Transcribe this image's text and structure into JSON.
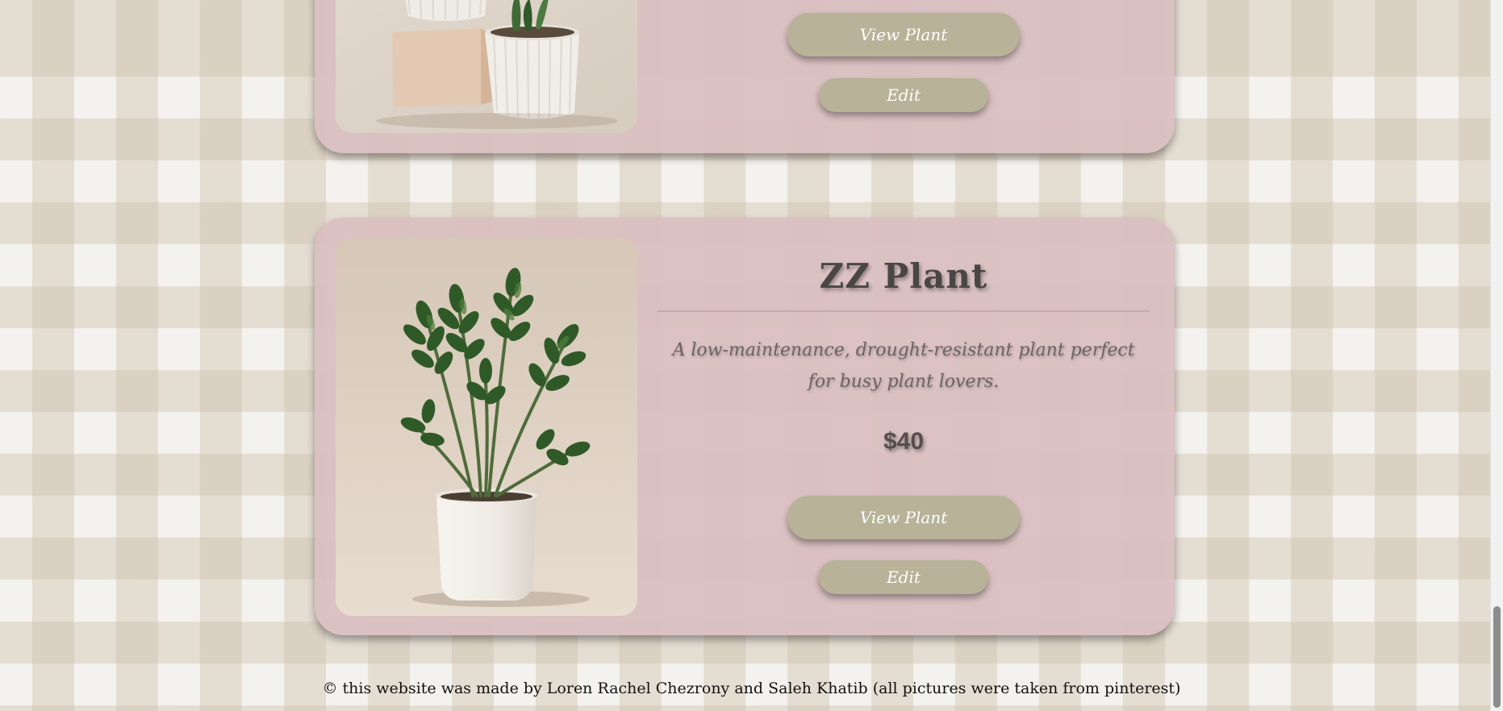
{
  "products": [
    {
      "image_icon": "white-pots-plant-photo",
      "view_label": "View Plant",
      "edit_label": "Edit"
    },
    {
      "name": "ZZ Plant",
      "description": "A low-maintenance, drought-resistant plant perfect for busy plant lovers.",
      "price": "$40",
      "image_icon": "zz-plant-photo",
      "view_label": "View Plant",
      "edit_label": "Edit"
    }
  ],
  "footer": {
    "text": "© this website was made by Loren Rachel Chezrony and Saleh Khatib (all pictures were taken from pinterest)"
  },
  "colors": {
    "card_background": "#d9bec1",
    "button": "#b8b298",
    "checker": "#cdc0ac"
  }
}
